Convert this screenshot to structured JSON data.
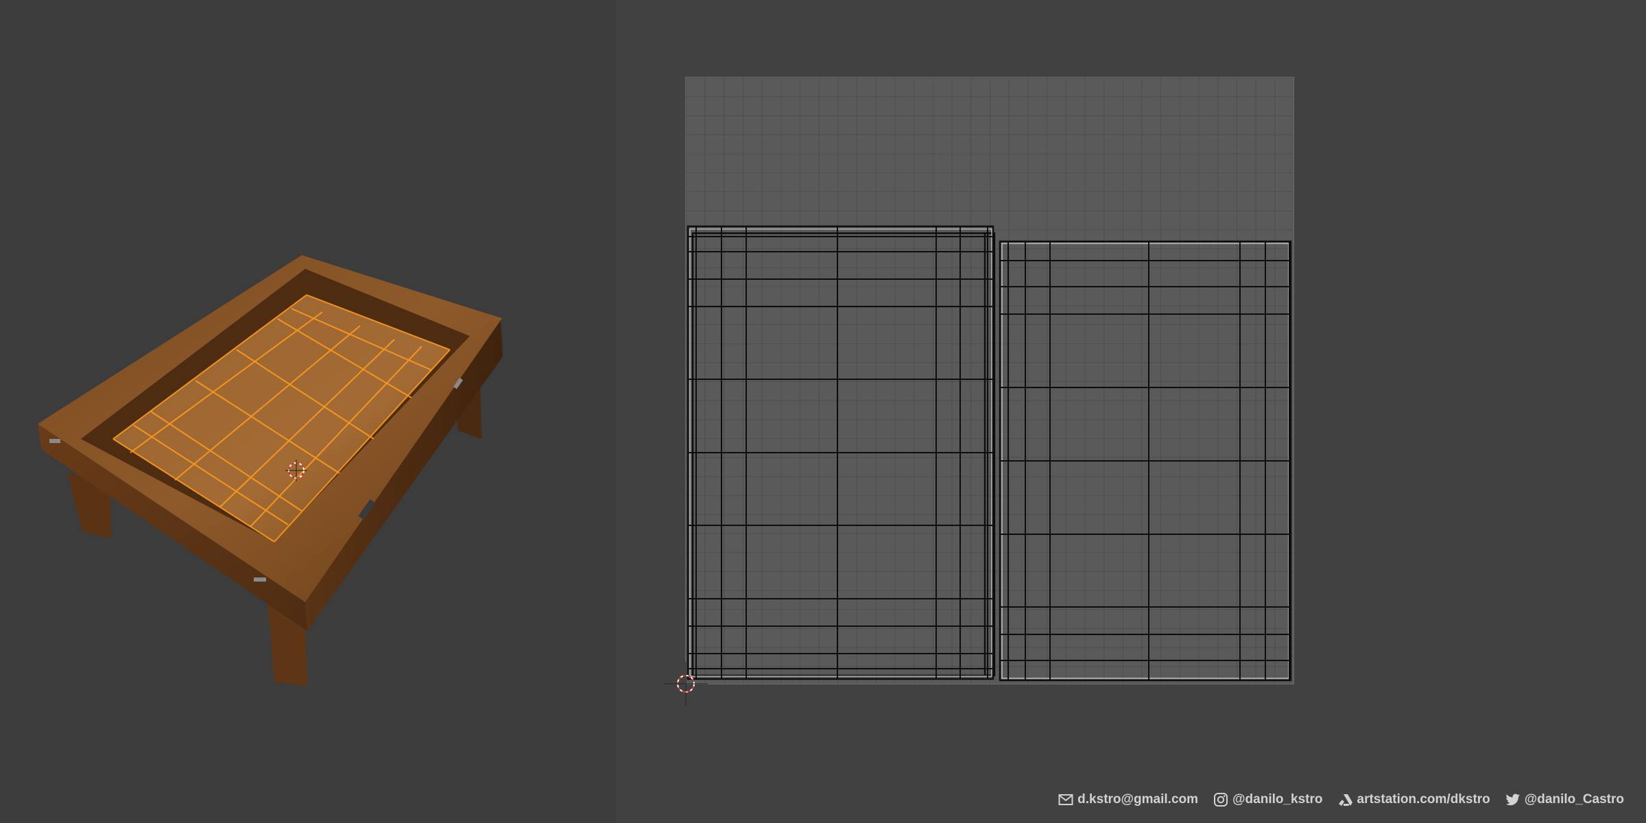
{
  "app": {
    "left_panel": "3d-viewport",
    "right_panel": "uv-editor"
  },
  "colors": {
    "viewport_bg": "#3c3c3c",
    "editor_bg": "#414141",
    "uv_grid": "#5a5a5a",
    "selection_highlight": "#ff9a1e",
    "wood": "#8a5426",
    "footer_text": "#d2d2d2"
  },
  "icons": {
    "email": "mail-icon",
    "instagram": "instagram-icon",
    "artstation": "artstation-icon",
    "twitter": "twitter-icon",
    "cursor": "3d-cursor-icon"
  },
  "footer": {
    "email": "d.kstro@gmail.com",
    "instagram": "@danilo_kstro",
    "artstation": "artstation.com/dkstro",
    "twitter": "@danilo_Castro"
  }
}
